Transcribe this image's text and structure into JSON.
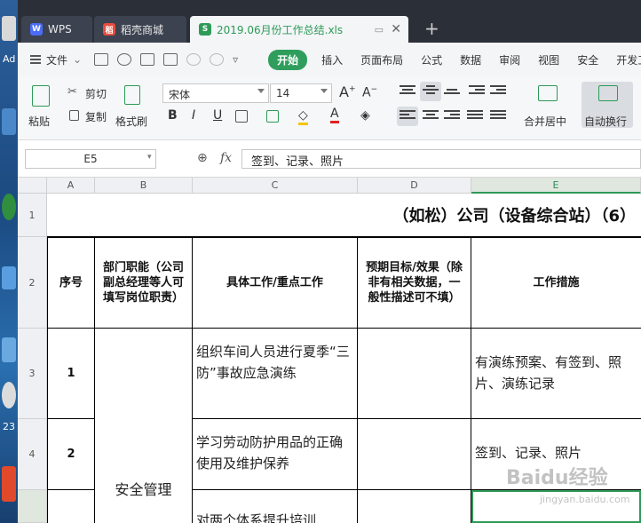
{
  "desktop": {
    "label_ad": "Ad",
    "label_23": "23"
  },
  "tabs": {
    "wps": "WPS",
    "store": "稻壳商城",
    "file": "2019.06月份工作总结.xls",
    "add": "+"
  },
  "menu": {
    "file": "文件",
    "start": "开始",
    "items": [
      "插入",
      "页面布局",
      "公式",
      "数据",
      "审阅",
      "视图",
      "安全",
      "开发工具"
    ]
  },
  "ribbon": {
    "paste": "粘贴",
    "cut": "剪切",
    "copy": "复制",
    "format_painter": "格式刷",
    "font_name": "宋体",
    "font_size": "14",
    "bold": "B",
    "italic": "I",
    "underline": "U",
    "merge_center": "合并居中",
    "wrap_text": "自动换行"
  },
  "formula_bar": {
    "name_box": "E5",
    "fx": "fx",
    "formula": "签到、记录、照片"
  },
  "columns": [
    "A",
    "B",
    "C",
    "D",
    "E"
  ],
  "rows": [
    "1",
    "2",
    "3",
    "4"
  ],
  "sheet": {
    "title": "（如松）公司（设备综合站）（6）",
    "headers": {
      "seq": "序号",
      "duty": "部门职能（公司副总经理等人可填写岗位职责）",
      "work": "具体工作/重点工作",
      "target": "预期目标/效果（除非有相关数据，一般性描述可不填）",
      "measure": "工作措施"
    },
    "row3": {
      "seq": "1",
      "work": "组织车间人员进行夏季“三防”事故应急演练",
      "measure": "有演练预案、有签到、照片、演练记录"
    },
    "row4": {
      "seq": "2",
      "work": "学习劳动防护用品的正确使用及维护保养",
      "measure": "签到、记录、照片"
    },
    "merged_duty": "安全管理",
    "row5_work": "对两个体系提升培训"
  },
  "watermark": {
    "main": "Baidu经验",
    "sub": "jingyan.baidu.com"
  }
}
